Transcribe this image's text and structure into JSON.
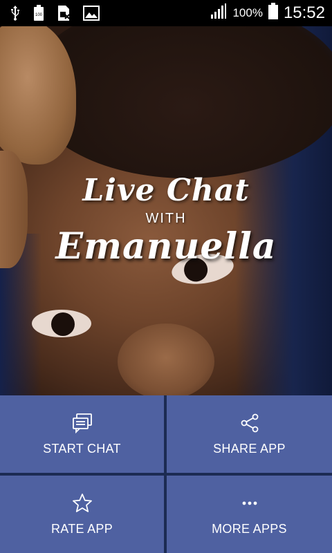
{
  "status_bar": {
    "icons": [
      "usb-icon",
      "battery-100-icon",
      "sim-icon",
      "image-icon",
      "signal-icon",
      "battery-icon"
    ],
    "battery_percent": "100%",
    "time": "15:52"
  },
  "hero": {
    "title_line1": "Live Chat",
    "title_line2": "WITH",
    "title_line3": "Emanuella"
  },
  "menu": {
    "start_chat": "START CHAT",
    "share_app": "SHARE APP",
    "rate_app": "RATE APP",
    "more_apps": "MORE APPS"
  },
  "colors": {
    "tile_bg": "#4f61a1",
    "grid_gap": "#1c2b52",
    "status_bar_bg": "#000000"
  }
}
